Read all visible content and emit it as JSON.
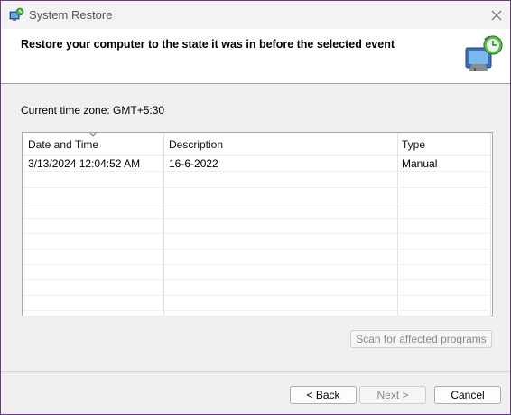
{
  "window": {
    "title": "System Restore",
    "close_icon": "close-icon"
  },
  "header": {
    "heading": "Restore your computer to the state it was in before the selected event",
    "icon": "system-restore-icon"
  },
  "timezone_label": "Current time zone: GMT+5:30",
  "table": {
    "columns": [
      "Date and Time",
      "Description",
      "Type"
    ],
    "sorted_column": "Date and Time",
    "rows": [
      {
        "date": "3/13/2024 12:04:52 AM",
        "description": "16-6-2022",
        "type": "Manual"
      }
    ]
  },
  "buttons": {
    "scan": "Scan for affected programs",
    "back": "< Back",
    "next": "Next >",
    "cancel": "Cancel"
  }
}
